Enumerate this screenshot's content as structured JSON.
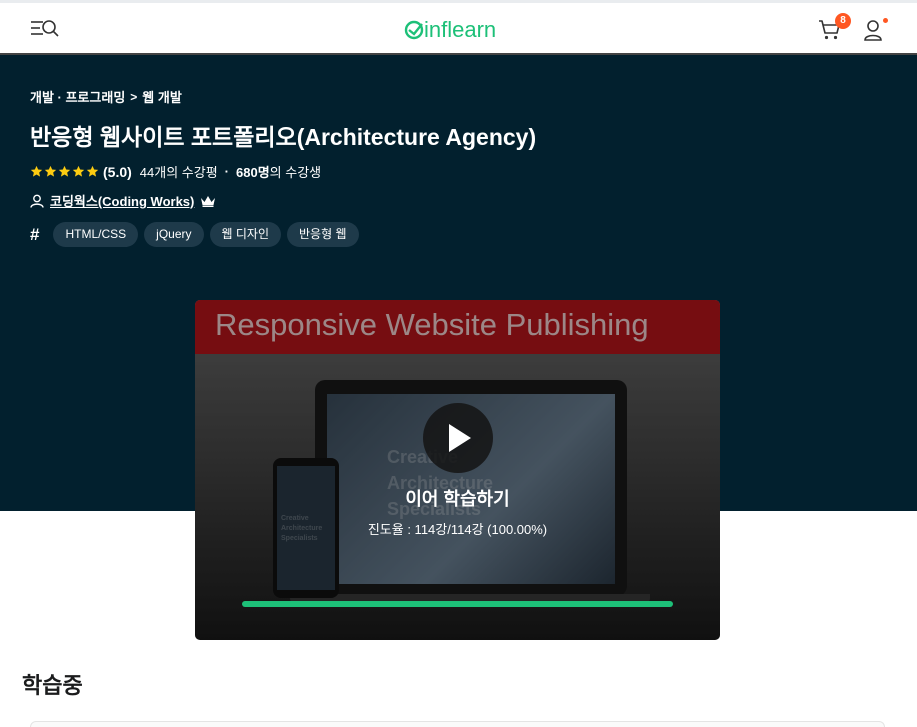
{
  "header": {
    "logo_text": "inflearn",
    "cart_count": "8",
    "accent_color": "#1dc078",
    "badge_color": "#ff5722"
  },
  "breadcrumb": {
    "items": [
      "개발 · 프로그래밍",
      "웹 개발"
    ],
    "separator": ">"
  },
  "course": {
    "title": "반응형 웹사이트 포트폴리오(Architecture Agency)",
    "rating": 5,
    "rating_text": "(5.0)",
    "reviews_text": "44개의 수강평",
    "dot": "·",
    "students_count": "680명",
    "students_suffix": "의 수강생",
    "instructor": "코딩웍스(Coding Works)",
    "tags": [
      "HTML/CSS",
      "jQuery",
      "웹 디자인",
      "반응형 웹"
    ]
  },
  "video": {
    "banner_text": "Responsive Website Publishing",
    "screen_text_laptop": "Creative Architecture Specialists",
    "screen_text_phone": "Creative Architecture Specialists",
    "continue_label": "이어 학습하기",
    "progress_label": "진도율 : 114강/114강 (100.00%)",
    "progress_fraction": 1.0
  },
  "section": {
    "title": "학습중"
  }
}
